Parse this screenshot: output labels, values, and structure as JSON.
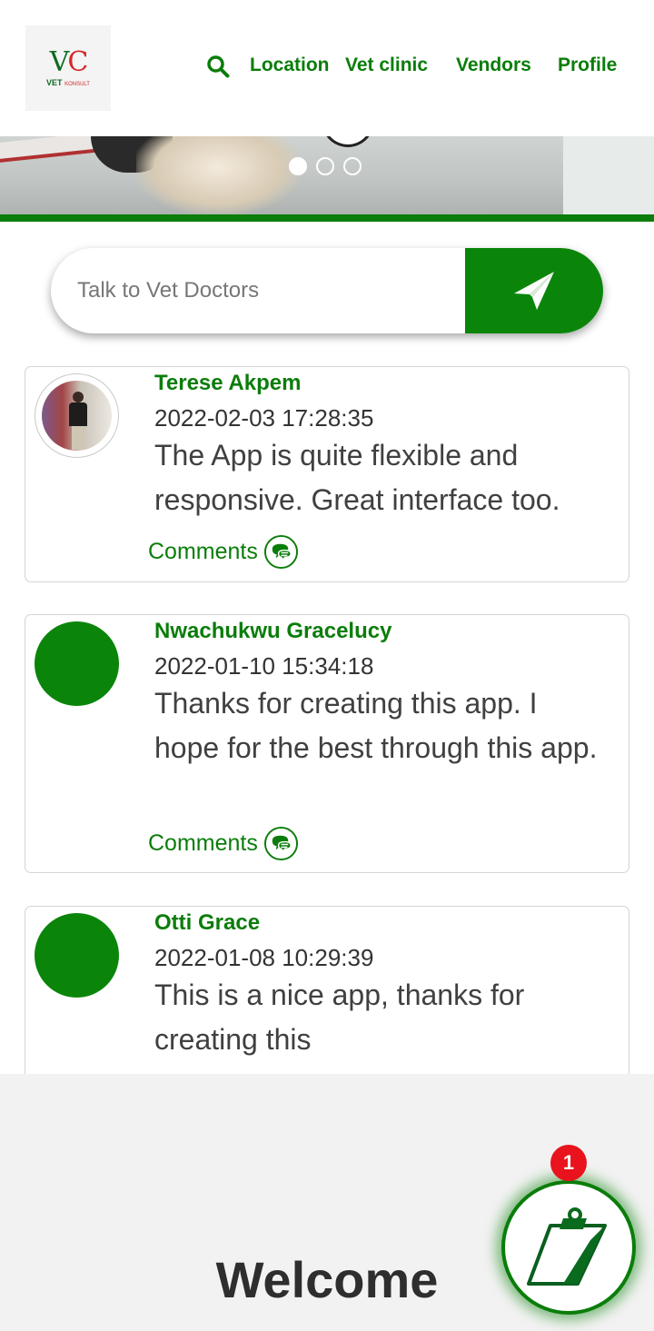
{
  "header": {
    "logo_text": "VC",
    "logo_subtitle": "VET",
    "logo_tag": "KONSULT",
    "nav": {
      "location": "Location",
      "vet_clinic": "Vet clinic",
      "vendors": "Vendors",
      "profile": "Profile"
    }
  },
  "carousel": {
    "slides": 3,
    "active_index": 0
  },
  "ask": {
    "placeholder": "Talk to Vet Doctors"
  },
  "posts": [
    {
      "name": "Terese Akpem",
      "date": "2022-02-03 17:28:35",
      "body": "The App is quite flexible and responsive. Great interface too.",
      "comments_label": "Comments"
    },
    {
      "name": "Nwachukwu Gracelucy",
      "date": "2022-01-10 15:34:18",
      "body": "Thanks for creating this app. I hope for the best through this app.",
      "comments_label": "Comments"
    },
    {
      "name": "Otti Grace",
      "date": "2022-01-08 10:29:39",
      "body": "This is a nice app, thanks for creating this"
    }
  ],
  "welcome": "Welcome",
  "fab": {
    "badge": "1",
    "icon": "clipboard-icon"
  },
  "colors": {
    "brand_green": "#0a7d0a",
    "badge_red": "#e8131c"
  }
}
